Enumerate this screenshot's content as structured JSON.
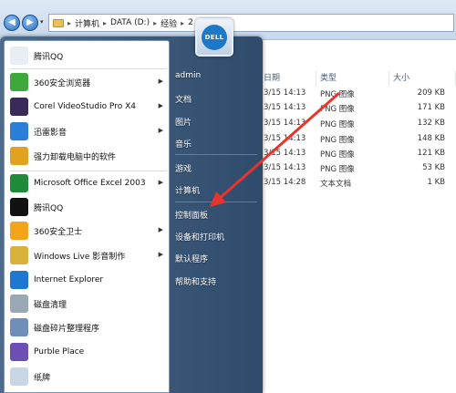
{
  "explorer": {
    "breadcrumb": [
      "计算机",
      "DATA (D:)",
      "经验",
      "2"
    ],
    "columns": {
      "date": "日期",
      "type": "类型",
      "size": "大小"
    },
    "files": [
      {
        "date": "3/15 14:13",
        "type": "PNG 图像",
        "size": "209 KB"
      },
      {
        "date": "3/15 14:13",
        "type": "PNG 图像",
        "size": "171 KB"
      },
      {
        "date": "3/15 14:13",
        "type": "PNG 图像",
        "size": "132 KB"
      },
      {
        "date": "3/15 14:13",
        "type": "PNG 图像",
        "size": "148 KB"
      },
      {
        "date": "3/15 14:13",
        "type": "PNG 图像",
        "size": "121 KB"
      },
      {
        "date": "3/15 14:13",
        "type": "PNG 图像",
        "size": "53 KB"
      },
      {
        "date": "3/15 14:28",
        "type": "文本文档",
        "size": "1 KB"
      }
    ]
  },
  "programs": [
    {
      "label": "腾讯QQ",
      "icon": "qq-icon-white",
      "color": "#e9eef4",
      "arrow": false
    },
    {
      "label": "360安全浏览器",
      "icon": "360-browser-icon",
      "color": "#3fa83a",
      "arrow": true
    },
    {
      "label": "Corel VideoStudio Pro X4",
      "icon": "videostudio-icon",
      "color": "#3a2a5a",
      "arrow": true
    },
    {
      "label": "迅雷影音",
      "icon": "xunlei-icon",
      "color": "#2b7ed6",
      "arrow": true
    },
    {
      "label": "强力卸载电脑中的软件",
      "icon": "uninstall-icon",
      "color": "#e0a21f",
      "arrow": false
    },
    {
      "label": "Microsoft Office Excel 2003",
      "icon": "excel-icon",
      "color": "#1f8a3a",
      "arrow": true
    },
    {
      "label": "腾讯QQ",
      "icon": "qq-penguin-icon",
      "color": "#111111",
      "arrow": false
    },
    {
      "label": "360安全卫士",
      "icon": "360-safe-icon",
      "color": "#f2a51a",
      "arrow": true
    },
    {
      "label": "Windows Live 影音制作",
      "icon": "movie-maker-icon",
      "color": "#d7b13a",
      "arrow": true
    },
    {
      "label": "Internet Explorer",
      "icon": "ie-icon",
      "color": "#1e78d2",
      "arrow": false
    },
    {
      "label": "磁盘清理",
      "icon": "disk-cleanup-icon",
      "color": "#9aa7b5",
      "arrow": false
    },
    {
      "label": "磁盘碎片整理程序",
      "icon": "defrag-icon",
      "color": "#6f8fb8",
      "arrow": false
    },
    {
      "label": "Purble Place",
      "icon": "purble-place-icon",
      "color": "#6d4fb3",
      "arrow": false
    },
    {
      "label": "纸牌",
      "icon": "solitaire-icon",
      "color": "#c9d6e6",
      "arrow": false
    }
  ],
  "right_items": [
    "admin",
    "文档",
    "图片",
    "音乐",
    "游戏",
    "计算机",
    "控制面板",
    "设备和打印机",
    "默认程序",
    "帮助和支持"
  ],
  "user_tile": {
    "logo_text": "DELL",
    "color": "#1d79c8"
  },
  "annotation": {
    "color": "#e8342a"
  }
}
